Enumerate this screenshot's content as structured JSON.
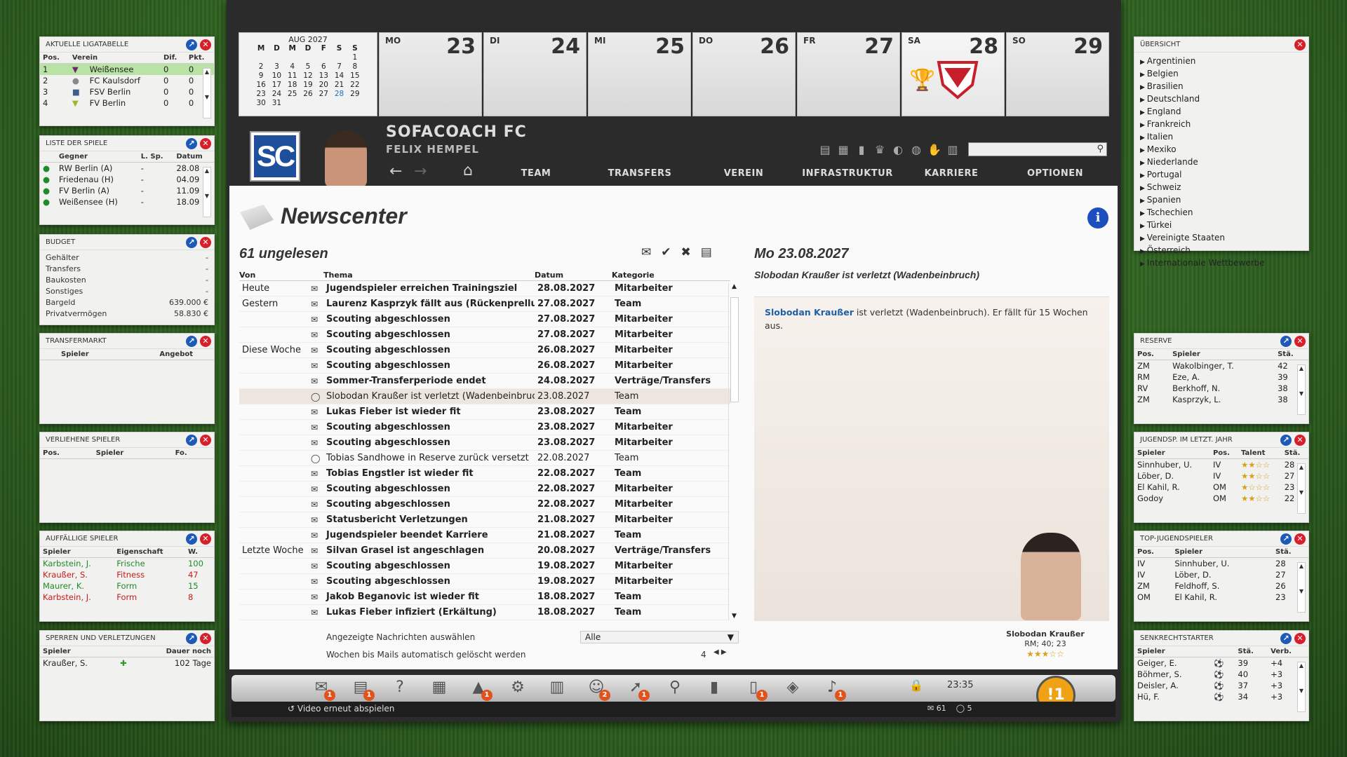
{
  "left": {
    "liga": {
      "title": "AKTUELLE LIGATABELLE",
      "cols": [
        "Pos.",
        "Verein",
        "Dif.",
        "Pkt."
      ],
      "rows": [
        {
          "pos": "1",
          "verein": "Weißensee",
          "dif": "0",
          "pkt": "0"
        },
        {
          "pos": "2",
          "verein": "FC Kaulsdorf",
          "dif": "0",
          "pkt": "0"
        },
        {
          "pos": "3",
          "verein": "FSV Berlin",
          "dif": "0",
          "pkt": "0"
        },
        {
          "pos": "4",
          "verein": "FV Berlin",
          "dif": "0",
          "pkt": "0"
        }
      ]
    },
    "spiele": {
      "title": "LISTE DER SPIELE",
      "cols": [
        "Gegner",
        "L. Sp.",
        "Datum"
      ],
      "rows": [
        {
          "gegner": "RW Berlin (A)",
          "lsp": "-",
          "datum": "28.08"
        },
        {
          "gegner": "Friedenau (H)",
          "lsp": "-",
          "datum": "04.09"
        },
        {
          "gegner": "FV Berlin (A)",
          "lsp": "-",
          "datum": "11.09"
        },
        {
          "gegner": "Weißensee (H)",
          "lsp": "-",
          "datum": "18.09"
        }
      ]
    },
    "budget": {
      "title": "BUDGET",
      "rows": [
        {
          "label": "Gehälter",
          "value": "-"
        },
        {
          "label": "Transfers",
          "value": "-"
        },
        {
          "label": "Baukosten",
          "value": "-"
        },
        {
          "label": "Sonstiges",
          "value": "-"
        },
        {
          "label": "Bargeld",
          "value": "639.000 €"
        },
        {
          "label": "Privatvermögen",
          "value": "58.830 €"
        }
      ]
    },
    "transfermarkt": {
      "title": "TRANSFERMARKT",
      "cols": [
        "Spieler",
        "Angebot"
      ]
    },
    "verliehen": {
      "title": "VERLIEHENE SPIELER",
      "cols": [
        "Pos.",
        "Spieler",
        "Fo."
      ]
    },
    "auffaellig": {
      "title": "AUFFÄLLIGE SPIELER",
      "cols": [
        "Spieler",
        "Eigenschaft",
        "W."
      ],
      "rows": [
        {
          "spieler": "Karbstein, J.",
          "eig": "Frische",
          "w": "100"
        },
        {
          "spieler": "Kraußer, S.",
          "eig": "Fitness",
          "w": "47"
        },
        {
          "spieler": "Maurer, K.",
          "eig": "Form",
          "w": "15"
        },
        {
          "spieler": "Karbstein, J.",
          "eig": "Form",
          "w": "8"
        }
      ]
    },
    "sperren": {
      "title": "SPERREN UND VERLETZUNGEN",
      "cols": [
        "Spieler",
        "Dauer noch"
      ],
      "rows": [
        {
          "spieler": "Kraußer, S.",
          "dauer": "102 Tage"
        }
      ]
    }
  },
  "calendar": {
    "month": "AUG 2027",
    "weekdays": [
      "M",
      "D",
      "M",
      "D",
      "F",
      "S",
      "S"
    ],
    "weeks": [
      [
        "",
        "",
        "",
        "",
        "",
        "",
        "1"
      ],
      [
        "2",
        "3",
        "4",
        "5",
        "6",
        "7",
        "8"
      ],
      [
        "9",
        "10",
        "11",
        "12",
        "13",
        "14",
        "15"
      ],
      [
        "16",
        "17",
        "18",
        "19",
        "20",
        "21",
        "22"
      ],
      [
        "23",
        "24",
        "25",
        "26",
        "27",
        "28",
        "29"
      ],
      [
        "30",
        "31",
        "",
        "",
        "",
        "",
        ""
      ]
    ],
    "days": [
      {
        "name": "MO",
        "num": "23"
      },
      {
        "name": "DI",
        "num": "24"
      },
      {
        "name": "MI",
        "num": "25"
      },
      {
        "name": "DO",
        "num": "26"
      },
      {
        "name": "FR",
        "num": "27"
      },
      {
        "name": "SA",
        "num": "28"
      },
      {
        "name": "SO",
        "num": "29"
      }
    ]
  },
  "club": {
    "logo": "SC",
    "name": "SOFACOACH FC",
    "coach": "FELIX HEMPEL"
  },
  "nav": [
    "TEAM",
    "TRANSFERS",
    "VEREIN",
    "INFRASTRUKTUR",
    "KARRIERE",
    "OPTIONEN"
  ],
  "newscenter": {
    "title": "Newscenter",
    "unread": "61 ungelesen",
    "cols": [
      "Von",
      "Thema",
      "Datum",
      "Kategorie"
    ],
    "rows": [
      {
        "von": "Heute",
        "thema": "Jugendspieler erreichen Trainingsziel",
        "datum": "28.08.2027",
        "kat": "Mitarbeiter",
        "bold": true,
        "icon": "mail"
      },
      {
        "von": "Gestern",
        "thema": "Laurenz Kasprzyk fällt aus (Rückenprellung)",
        "datum": "27.08.2027",
        "kat": "Team",
        "bold": true,
        "icon": "mail"
      },
      {
        "von": "",
        "thema": "Scouting abgeschlossen",
        "datum": "27.08.2027",
        "kat": "Mitarbeiter",
        "bold": true,
        "icon": "mail"
      },
      {
        "von": "",
        "thema": "Scouting abgeschlossen",
        "datum": "27.08.2027",
        "kat": "Mitarbeiter",
        "bold": true,
        "icon": "mail"
      },
      {
        "von": "Diese Woche",
        "thema": "Scouting abgeschlossen",
        "datum": "26.08.2027",
        "kat": "Mitarbeiter",
        "bold": true,
        "icon": "mail"
      },
      {
        "von": "",
        "thema": "Scouting abgeschlossen",
        "datum": "26.08.2027",
        "kat": "Mitarbeiter",
        "bold": true,
        "icon": "mail"
      },
      {
        "von": "",
        "thema": "Sommer-Transferperiode endet",
        "datum": "24.08.2027",
        "kat": "Verträge/Transfers",
        "bold": true,
        "icon": "mail"
      },
      {
        "von": "",
        "thema": "Slobodan Kraußer ist verletzt (Wadenbeinbruch)",
        "datum": "23.08.2027",
        "kat": "Team",
        "bold": false,
        "icon": "read",
        "hl": true
      },
      {
        "von": "",
        "thema": "Lukas Fieber ist wieder fit",
        "datum": "23.08.2027",
        "kat": "Team",
        "bold": true,
        "icon": "mail"
      },
      {
        "von": "",
        "thema": "Scouting abgeschlossen",
        "datum": "23.08.2027",
        "kat": "Mitarbeiter",
        "bold": true,
        "icon": "mail"
      },
      {
        "von": "",
        "thema": "Scouting abgeschlossen",
        "datum": "23.08.2027",
        "kat": "Mitarbeiter",
        "bold": true,
        "icon": "mail"
      },
      {
        "von": "",
        "thema": "Tobias Sandhowe in Reserve zurück versetzt",
        "datum": "22.08.2027",
        "kat": "Team",
        "bold": false,
        "icon": "read"
      },
      {
        "von": "",
        "thema": "Tobias Engstler ist wieder fit",
        "datum": "22.08.2027",
        "kat": "Team",
        "bold": true,
        "icon": "mail"
      },
      {
        "von": "",
        "thema": "Scouting abgeschlossen",
        "datum": "22.08.2027",
        "kat": "Mitarbeiter",
        "bold": true,
        "icon": "mail"
      },
      {
        "von": "",
        "thema": "Scouting abgeschlossen",
        "datum": "22.08.2027",
        "kat": "Mitarbeiter",
        "bold": true,
        "icon": "mail"
      },
      {
        "von": "",
        "thema": "Statusbericht Verletzungen",
        "datum": "21.08.2027",
        "kat": "Mitarbeiter",
        "bold": true,
        "icon": "mail"
      },
      {
        "von": "",
        "thema": "Jugendspieler beendet Karriere",
        "datum": "21.08.2027",
        "kat": "Team",
        "bold": true,
        "icon": "mail"
      },
      {
        "von": "Letzte Woche",
        "thema": "Silvan Grasel ist angeschlagen",
        "datum": "20.08.2027",
        "kat": "Verträge/Transfers",
        "bold": true,
        "icon": "mail"
      },
      {
        "von": "",
        "thema": "Scouting abgeschlossen",
        "datum": "19.08.2027",
        "kat": "Mitarbeiter",
        "bold": true,
        "icon": "mail"
      },
      {
        "von": "",
        "thema": "Scouting abgeschlossen",
        "datum": "19.08.2027",
        "kat": "Mitarbeiter",
        "bold": true,
        "icon": "mail"
      },
      {
        "von": "",
        "thema": "Jakob Beganovic ist wieder fit",
        "datum": "18.08.2027",
        "kat": "Team",
        "bold": true,
        "icon": "mail"
      },
      {
        "von": "",
        "thema": "Lukas Fieber infiziert (Erkältung)",
        "datum": "18.08.2027",
        "kat": "Team",
        "bold": true,
        "icon": "mail"
      }
    ],
    "filter_label": "Angezeigte Nachrichten auswählen",
    "filter_value": "Alle",
    "weeks_label": "Wochen bis Mails automatisch gelöscht werden",
    "weeks_value": "4"
  },
  "detail": {
    "date": "Mo 23.08.2027",
    "subject": "Slobodan Kraußer ist verletzt (Wadenbeinbruch)",
    "player_link": "Slobodan Kraußer",
    "text": " ist verletzt (Wadenbeinbruch). Er fällt für 15 Wochen aus.",
    "player_name": "Slobodan Kraußer",
    "player_info": "RM; 40; 23",
    "stars": "★★★☆☆"
  },
  "bottom": {
    "badges": [
      "1",
      "1",
      "",
      "",
      "1",
      "",
      "",
      "2",
      "1",
      "",
      "",
      "1",
      "",
      "1"
    ],
    "time": "23:35",
    "alert": "!1",
    "replay": "Video erneut abspielen",
    "mail_count": "61",
    "msg_count": "5"
  },
  "right": {
    "overview": {
      "title": "ÜBERSICHT",
      "items": [
        "Argentinien",
        "Belgien",
        "Brasilien",
        "Deutschland",
        "England",
        "Frankreich",
        "Italien",
        "Mexiko",
        "Niederlande",
        "Portugal",
        "Schweiz",
        "Spanien",
        "Tschechien",
        "Türkei",
        "Vereinigte Staaten",
        "Österreich",
        "Internationale Wettbewerbe"
      ]
    },
    "reserve": {
      "title": "RESERVE",
      "cols": [
        "Pos.",
        "Spieler",
        "Stä."
      ],
      "rows": [
        {
          "pos": "ZM",
          "spieler": "Wakolbinger, T.",
          "sta": "42"
        },
        {
          "pos": "RM",
          "spieler": "Eze, A.",
          "sta": "39"
        },
        {
          "pos": "RV",
          "spieler": "Berkhoff, N.",
          "sta": "38"
        },
        {
          "pos": "ZM",
          "spieler": "Kasprzyk, L.",
          "sta": "38"
        }
      ]
    },
    "jugend": {
      "title": "JUGENDSP. IM LETZT. JAHR",
      "cols": [
        "Spieler",
        "Pos.",
        "Talent",
        "Stä."
      ],
      "rows": [
        {
          "spieler": "Sinnhuber, U.",
          "pos": "IV",
          "talent": "★★☆☆",
          "sta": "28"
        },
        {
          "spieler": "Löber, D.",
          "pos": "IV",
          "talent": "★★☆☆",
          "sta": "27"
        },
        {
          "spieler": "El Kahil, R.",
          "pos": "OM",
          "talent": "★☆☆☆",
          "sta": "23"
        },
        {
          "spieler": "Godoy",
          "pos": "OM",
          "talent": "★★☆☆",
          "sta": "22"
        }
      ]
    },
    "topjugend": {
      "title": "TOP-JUGENDSPIELER",
      "cols": [
        "Pos.",
        "Spieler",
        "Stä."
      ],
      "rows": [
        {
          "pos": "IV",
          "spieler": "Sinnhuber, U.",
          "sta": "28"
        },
        {
          "pos": "IV",
          "spieler": "Löber, D.",
          "sta": "27"
        },
        {
          "pos": "ZM",
          "spieler": "Feldhoff, S.",
          "sta": "26"
        },
        {
          "pos": "OM",
          "spieler": "El Kahil, R.",
          "sta": "23"
        }
      ]
    },
    "senkrecht": {
      "title": "SENKRECHTSTARTER",
      "cols": [
        "Spieler",
        "Stä.",
        "Verb."
      ],
      "rows": [
        {
          "spieler": "Geiger, E.",
          "sta": "39",
          "verb": "+4"
        },
        {
          "spieler": "Böhmer, S.",
          "sta": "40",
          "verb": "+3"
        },
        {
          "spieler": "Deisler, A.",
          "sta": "37",
          "verb": "+3"
        },
        {
          "spieler": "Hü, F.",
          "sta": "34",
          "verb": "+3"
        }
      ]
    }
  },
  "colors": {
    "accent_blue": "#1d59b8",
    "close_red": "#d81e2a",
    "alert": "#f0a215",
    "badge": "#e2521c"
  }
}
